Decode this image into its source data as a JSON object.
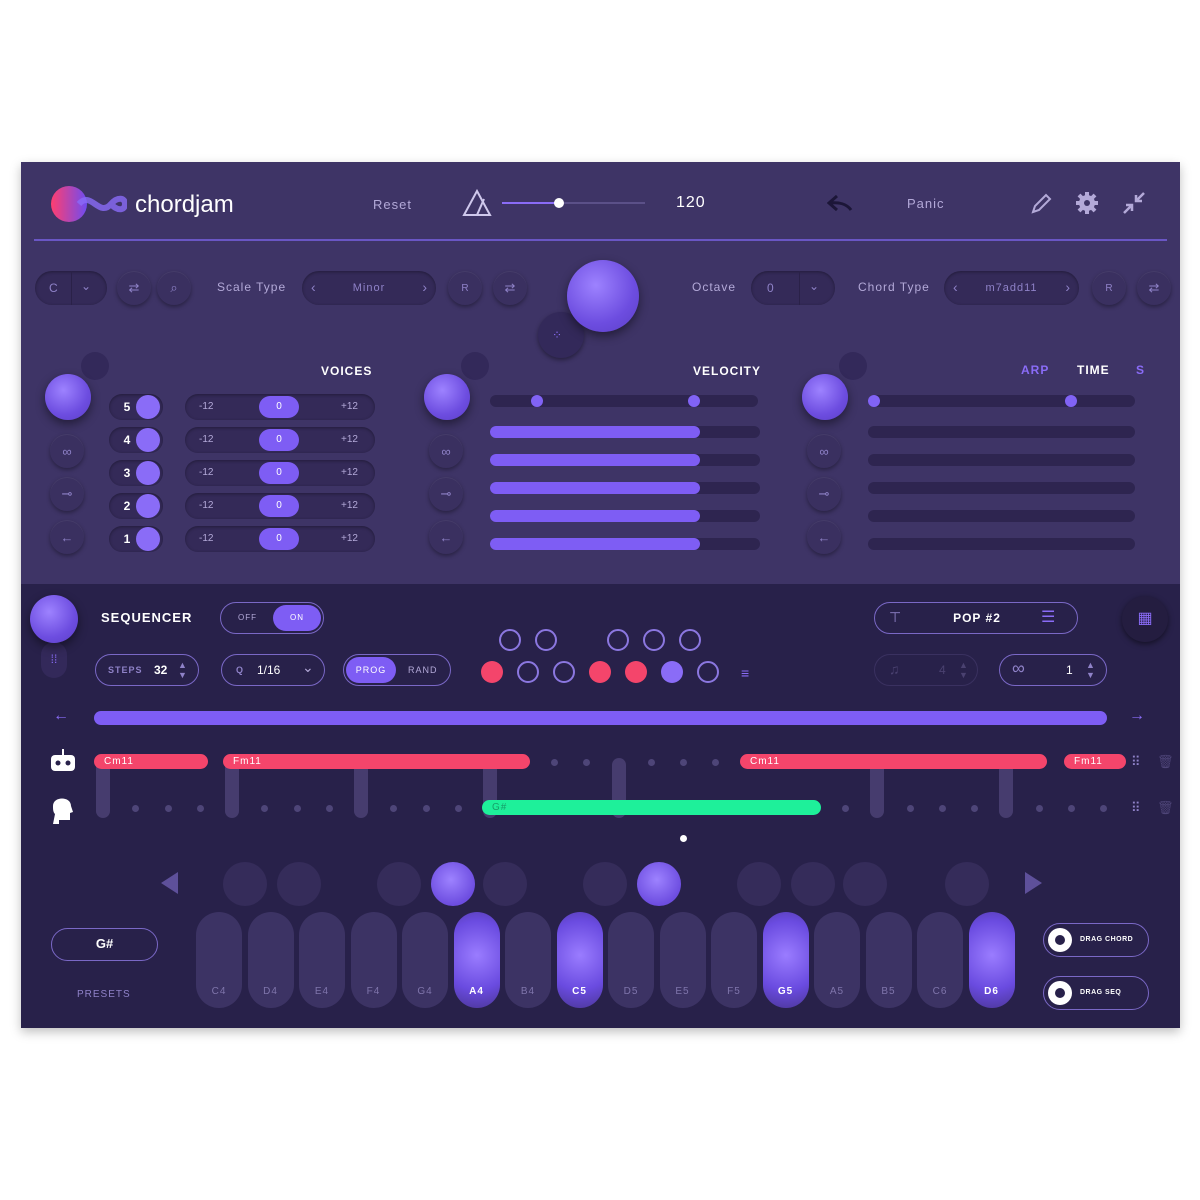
{
  "app": {
    "name": "chordjam"
  },
  "header": {
    "reset_label": "Reset",
    "tempo": "120",
    "panic_label": "Panic"
  },
  "controls": {
    "root_note": "C",
    "scale_type_label": "Scale Type",
    "scale_type_value": "Minor",
    "octave_label": "Octave",
    "octave_value": "0",
    "chord_type_label": "Chord Type",
    "chord_type_value": "m7add11",
    "randomize_label": "R"
  },
  "voices": {
    "title": "VOICES",
    "rows": [
      {
        "num": "5",
        "min": "-12",
        "val": "0",
        "max": "+12"
      },
      {
        "num": "4",
        "min": "-12",
        "val": "0",
        "max": "+12"
      },
      {
        "num": "3",
        "min": "-12",
        "val": "0",
        "max": "+12"
      },
      {
        "num": "2",
        "min": "-12",
        "val": "0",
        "max": "+12"
      },
      {
        "num": "1",
        "min": "-12",
        "val": "0",
        "max": "+12"
      }
    ]
  },
  "velocity": {
    "title": "VELOCITY",
    "levels": [
      0.8,
      0.8,
      0.8,
      0.8,
      0.8
    ]
  },
  "arp": {
    "tab_arp": "ARP",
    "tab_time": "TIME",
    "tab_s": "S"
  },
  "sequencer": {
    "title": "SEQUENCER",
    "off_label": "OFF",
    "on_label": "ON",
    "steps_label": "STEPS",
    "steps_value": "32",
    "quantize_label": "Q",
    "quantize_value": "1/16",
    "prog_label": "PROG",
    "rand_label": "RAND",
    "preset_name": "POP #2",
    "notes_value": "4",
    "loop_value": "1",
    "chords": [
      {
        "name": "Cm11"
      },
      {
        "name": "Fm11"
      },
      {
        "name": "Cm11"
      },
      {
        "name": "Fm11"
      }
    ],
    "melody_note": "G#"
  },
  "keyboard": {
    "current_chord": "G#",
    "presets_label": "PRESETS",
    "white_keys": [
      "C4",
      "D4",
      "E4",
      "F4",
      "G4",
      "A4",
      "B4",
      "C5",
      "D5",
      "E5",
      "F5",
      "G5",
      "A5",
      "B5",
      "C6",
      "D6"
    ],
    "active_keys": [
      "A4",
      "C5",
      "G5",
      "D6"
    ],
    "drag_chord_label": "DRAG CHORD",
    "drag_seq_label": "DRAG SEQ"
  },
  "colors": {
    "accent": "#7e5df4",
    "chord": "#f4456b",
    "melody": "#1ef09a",
    "panel": "#3e3466",
    "bottom": "#28214a"
  }
}
